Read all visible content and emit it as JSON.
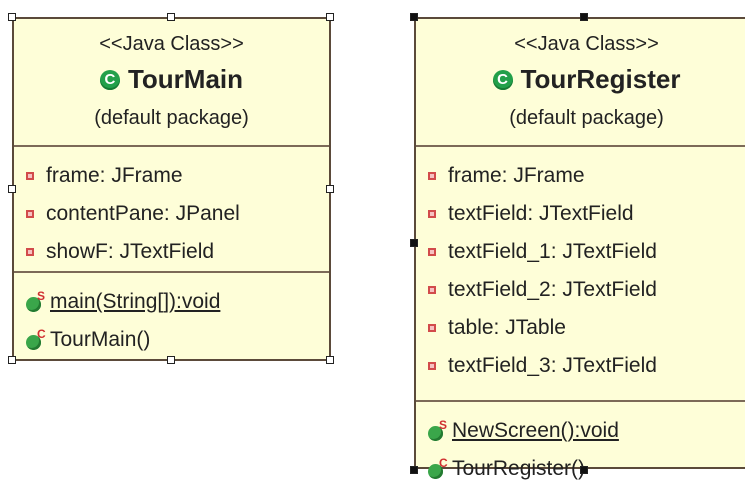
{
  "classes": [
    {
      "stereotype": "<<Java Class>>",
      "icon_letter": "C",
      "name": "TourMain",
      "package": "(default package)",
      "fields": [
        {
          "label": "frame: JFrame"
        },
        {
          "label": "contentPane: JPanel"
        },
        {
          "label": "showF: JTextField"
        }
      ],
      "methods": [
        {
          "modifier": "S",
          "label": "main(String[]):void"
        },
        {
          "modifier": "C",
          "label": "TourMain()"
        }
      ]
    },
    {
      "stereotype": "<<Java Class>>",
      "icon_letter": "C",
      "name": "TourRegister",
      "package": "(default package)",
      "fields": [
        {
          "label": "frame: JFrame"
        },
        {
          "label": "textField: JTextField"
        },
        {
          "label": "textField_1: JTextField"
        },
        {
          "label": "textField_2: JTextField"
        },
        {
          "label": "table: JTable"
        },
        {
          "label": "textField_3: JTextField"
        }
      ],
      "methods": [
        {
          "modifier": "S",
          "label": "NewScreen():void"
        },
        {
          "modifier": "C",
          "label": "TourRegister()"
        }
      ]
    }
  ],
  "colors": {
    "box_fill": "#fefed8",
    "box_border": "#5b4a3a",
    "class_icon": "#22a04a",
    "field_icon": "#d24b4b",
    "method_icon": "#3aa64a",
    "modifier": "#d03030"
  },
  "icons": {
    "class": "class-c-icon",
    "field": "private-field-icon",
    "static_method": "public-static-method-icon",
    "constructor": "public-constructor-icon"
  }
}
